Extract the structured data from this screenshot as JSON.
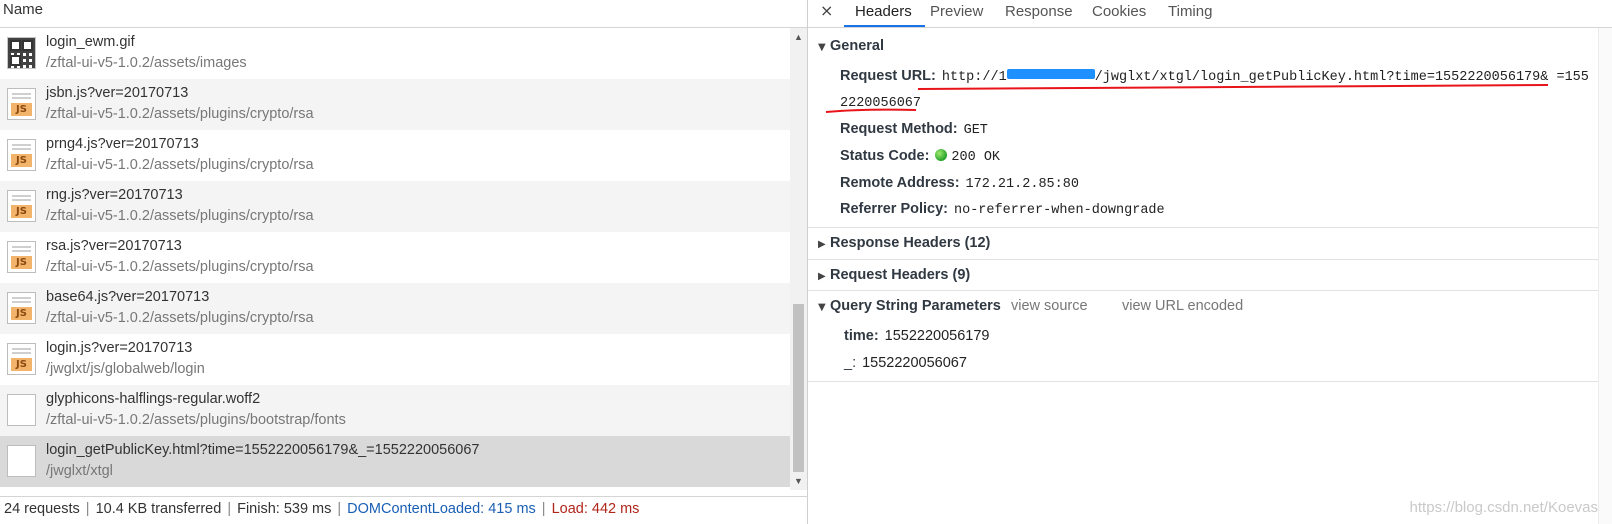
{
  "list": {
    "column_header": "Name",
    "rows": [
      {
        "name": "login_ewm.gif",
        "path": "/zftal-ui-v5-1.0.2/assets/images",
        "icon": "qr-image-icon"
      },
      {
        "name": "jsbn.js?ver=20170713",
        "path": "/zftal-ui-v5-1.0.2/assets/plugins/crypto/rsa",
        "icon": "js-file-icon"
      },
      {
        "name": "prng4.js?ver=20170713",
        "path": "/zftal-ui-v5-1.0.2/assets/plugins/crypto/rsa",
        "icon": "js-file-icon"
      },
      {
        "name": "rng.js?ver=20170713",
        "path": "/zftal-ui-v5-1.0.2/assets/plugins/crypto/rsa",
        "icon": "js-file-icon"
      },
      {
        "name": "rsa.js?ver=20170713",
        "path": "/zftal-ui-v5-1.0.2/assets/plugins/crypto/rsa",
        "icon": "js-file-icon"
      },
      {
        "name": "base64.js?ver=20170713",
        "path": "/zftal-ui-v5-1.0.2/assets/plugins/crypto/rsa",
        "icon": "js-file-icon"
      },
      {
        "name": "login.js?ver=20170713",
        "path": "/jwglxt/js/globalweb/login",
        "icon": "js-file-icon"
      },
      {
        "name": "glyphicons-halflings-regular.woff2",
        "path": "/zftal-ui-v5-1.0.2/assets/plugins/bootstrap/fonts",
        "icon": "blank-file-icon"
      },
      {
        "name": "login_getPublicKey.html?time=1552220056179&_=1552220056067",
        "path": "/jwglxt/xtgl",
        "icon": "blank-file-icon",
        "selected": true
      }
    ]
  },
  "status": {
    "requests": "24 requests",
    "transferred": "10.4 KB transferred",
    "finish": "Finish: 539 ms",
    "dom_loaded": "DOMContentLoaded: 415 ms",
    "load": "Load: 442 ms",
    "sep": "|",
    "dom_color": "#1a5fb4",
    "load_color": "#b1261b"
  },
  "tabs": {
    "close": "×",
    "items": [
      "Headers",
      "Preview",
      "Response",
      "Cookies",
      "Timing"
    ],
    "active": "Headers"
  },
  "general": {
    "title": "General",
    "request_url_label": "Request URL:",
    "request_url_value_1": "http://1",
    "request_url_value_2": "/jwglxt/xtgl/login_getPublicKey.html?time=1552220056179& =155",
    "request_url_value_3": "2220056067",
    "request_method_label": "Request Method:",
    "request_method_value": "GET",
    "status_code_label": "Status Code:",
    "status_code_value": "200 OK",
    "remote_address_label": "Remote Address:",
    "remote_address_value": "172.21.2.85:80",
    "referrer_policy_label": "Referrer Policy:",
    "referrer_policy_value": "no-referrer-when-downgrade"
  },
  "response_headers": {
    "title": "Response Headers (12)"
  },
  "request_headers": {
    "title": "Request Headers (9)"
  },
  "query": {
    "title": "Query String Parameters",
    "view_source": "view source",
    "view_url_encoded": "view URL encoded",
    "params": [
      {
        "key": "time:",
        "value": "1552220056179"
      },
      {
        "key": "_:",
        "value": "1552220056067"
      }
    ]
  },
  "watermark": "https://blog.csdn.net/Koevas",
  "colors": {
    "accent": "#1a73e8",
    "annotation_red": "#e8141a",
    "redaction_blue": "#1e90ff"
  }
}
